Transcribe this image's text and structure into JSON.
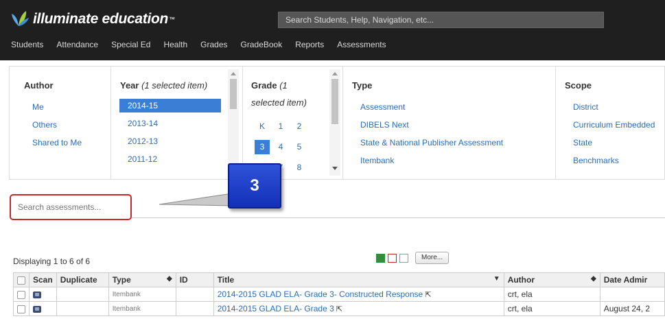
{
  "header": {
    "logo_text": "illuminate education",
    "logo_tm": "™",
    "search_placeholder": "Search Students, Help, Navigation, etc..."
  },
  "nav": [
    "Students",
    "Attendance",
    "Special Ed",
    "Health",
    "Grades",
    "GradeBook",
    "Reports",
    "Assessments"
  ],
  "filters": {
    "author": {
      "title": "Author",
      "items": [
        "Me",
        "Others",
        "Shared to Me"
      ]
    },
    "year": {
      "title": "Year",
      "selected_note": "(1 selected item)",
      "items": [
        "2014-15",
        "2013-14",
        "2012-13",
        "2011-12"
      ],
      "selected": "2014-15"
    },
    "grade": {
      "title": "Grade",
      "note_line1": "(1",
      "note_line2": "selected item)",
      "cells": [
        "K",
        "1",
        "2",
        "3",
        "4",
        "5",
        "7",
        "8"
      ],
      "selected": "3"
    },
    "type": {
      "title": "Type",
      "items": [
        "Assessment",
        "DIBELS Next",
        "State & National Publisher Assessment",
        "Itembank"
      ]
    },
    "scope": {
      "title": "Scope",
      "items": [
        "District",
        "Curriculum Embedded",
        "State",
        "Benchmarks"
      ]
    }
  },
  "search_assessments": {
    "placeholder": "Search assessments..."
  },
  "callout": {
    "number": "3",
    "color": "#1f40c8"
  },
  "results": {
    "displaying": "Displaying 1 to 6 of 6",
    "more_label": "More...",
    "columns": [
      "",
      "Scan",
      "Duplicate",
      "Type",
      "ID",
      "Title",
      "Author",
      "Date Admir"
    ],
    "rows": [
      {
        "type": "Itembank",
        "id": "",
        "title": "2014-2015 GLAD ELA- Grade 3- Constructed Response",
        "author": "crt, ela",
        "date": ""
      },
      {
        "type": "Itembank",
        "id": "",
        "title": "2014-2015 GLAD ELA- Grade 3",
        "author": "crt, ela",
        "date": "August 24, 2"
      }
    ]
  },
  "colors": {
    "topbar": "#1f1f1f",
    "link": "#2a6cb5",
    "selected": "#3a7fd5",
    "highlight_border": "#c62828"
  }
}
